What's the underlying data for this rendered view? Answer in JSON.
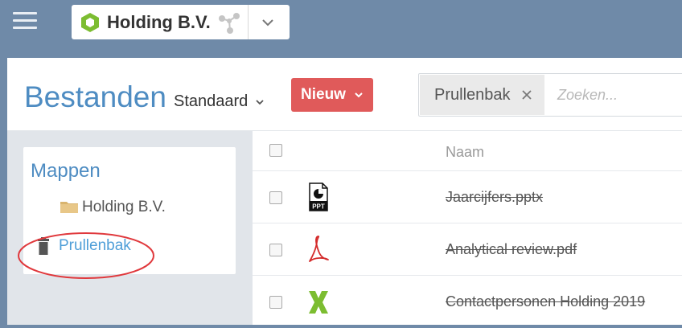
{
  "org_selector": {
    "name": "Holding B.V."
  },
  "page": {
    "title": "Bestanden",
    "view": "Standaard",
    "new_button": "Nieuw"
  },
  "search": {
    "filter_chip": "Prullenbak",
    "placeholder": "Zoeken..."
  },
  "sidebar": {
    "section_title": "Mappen",
    "folders": [
      {
        "label": "Holding B.V."
      }
    ],
    "trash": {
      "label": "Prullenbak",
      "highlighted": true
    }
  },
  "file_list": {
    "column_header": "Naam",
    "files": [
      {
        "name": "Jaarcijfers.pptx",
        "icon": "ppt-file-icon",
        "deleted": true
      },
      {
        "name": "Analytical review.pdf",
        "icon": "pdf-file-icon",
        "deleted": true
      },
      {
        "name": "Contactpersonen Holding 2019",
        "icon": "excel-file-icon",
        "deleted": true
      }
    ]
  },
  "colors": {
    "topbar": "#6f8aa8",
    "accent_blue": "#4e8cc2",
    "new_button": "#e05a5a",
    "highlight_ring": "#e0383c",
    "excel_green": "#7cbd31",
    "pdf_red": "#d42b2b"
  }
}
